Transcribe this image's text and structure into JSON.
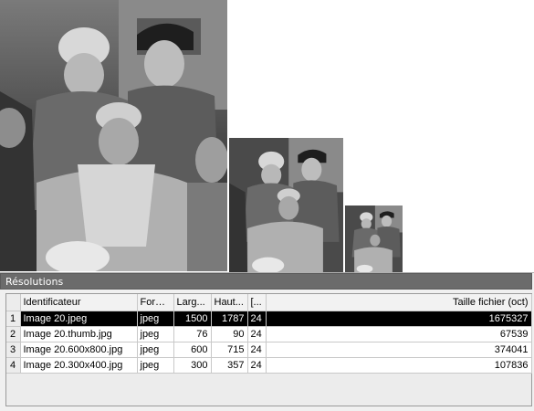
{
  "images": {
    "large": {
      "name": "Image 20.jpeg"
    },
    "medium": {
      "name": "Image 20.600x800.jpg"
    },
    "small": {
      "name": "Image 20.300x400.jpg"
    }
  },
  "panel": {
    "title": "Résolutions",
    "columns": [
      "Identificateur",
      "Form...",
      "Larg...",
      "Haut...",
      "[...",
      "Taille fichier (oct)"
    ],
    "rows": [
      {
        "num": "1",
        "id": "Image 20.jpeg",
        "format": "jpeg",
        "width": "1500",
        "height": "1787",
        "depth": "24",
        "size": "1675327",
        "selected": true
      },
      {
        "num": "2",
        "id": "Image 20.thumb.jpg",
        "format": "jpeg",
        "width": "76",
        "height": "90",
        "depth": "24",
        "size": "67539",
        "selected": false
      },
      {
        "num": "3",
        "id": "Image 20.600x800.jpg",
        "format": "jpeg",
        "width": "600",
        "height": "715",
        "depth": "24",
        "size": "374041",
        "selected": false
      },
      {
        "num": "4",
        "id": "Image 20.300x400.jpg",
        "format": "jpeg",
        "width": "300",
        "height": "357",
        "depth": "24",
        "size": "107836",
        "selected": false
      }
    ]
  }
}
